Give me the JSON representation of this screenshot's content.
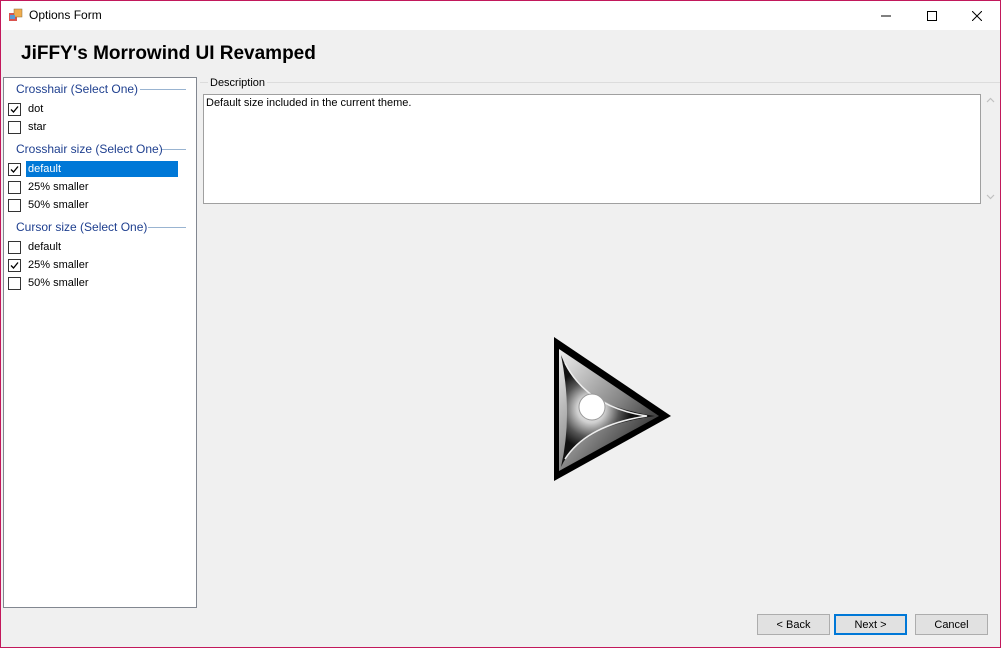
{
  "window": {
    "title": "Options Form"
  },
  "header": {
    "title": "JiFFY's Morrowind UI Revamped"
  },
  "groups": [
    {
      "title": "Crosshair (Select One)",
      "options": [
        {
          "label": "dot",
          "checked": true,
          "selected": false
        },
        {
          "label": "star",
          "checked": false,
          "selected": false
        }
      ]
    },
    {
      "title": "Crosshair size (Select One)",
      "options": [
        {
          "label": "default",
          "checked": true,
          "selected": true
        },
        {
          "label": "25% smaller",
          "checked": false,
          "selected": false
        },
        {
          "label": "50% smaller",
          "checked": false,
          "selected": false
        }
      ]
    },
    {
      "title": "Cursor size (Select One)",
      "options": [
        {
          "label": "default",
          "checked": false,
          "selected": false
        },
        {
          "label": "25% smaller",
          "checked": true,
          "selected": false
        },
        {
          "label": "50% smaller",
          "checked": false,
          "selected": false
        }
      ]
    }
  ],
  "description": {
    "legend": "Description",
    "text": "Default size included in the current theme."
  },
  "buttons": {
    "back": "< Back",
    "next": "Next >",
    "cancel": "Cancel"
  },
  "colors": {
    "selection": "#0078d7",
    "group_header": "#1e3f8f",
    "window_border": "#c2185b"
  },
  "icons": {
    "app": "app-icon",
    "minimize": "minimize-icon",
    "maximize": "maximize-icon",
    "close": "close-icon",
    "preview": "cursor-preview-image"
  }
}
